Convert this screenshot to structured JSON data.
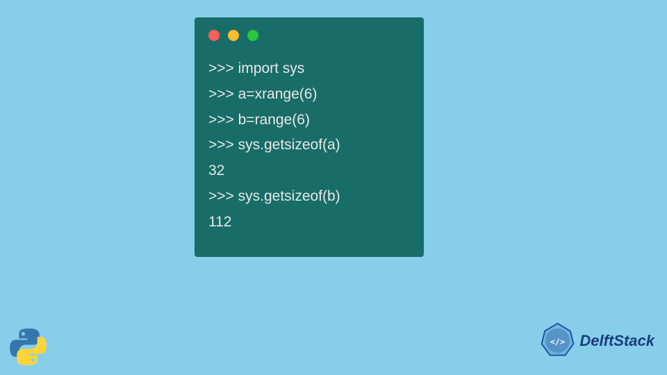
{
  "terminal": {
    "lines": [
      ">>> import sys",
      ">>> a=xrange(6)",
      ">>> b=range(6)",
      ">>> sys.getsizeof(a)",
      "32",
      ">>> sys.getsizeof(b)",
      "112"
    ]
  },
  "branding": {
    "name": "DelftStack"
  },
  "colors": {
    "background": "#87ceeb",
    "terminal": "#186d68",
    "text": "#e8e8e8",
    "dotRed": "#ff5f56",
    "dotYellow": "#ffbd2e",
    "dotGreen": "#27c93f"
  }
}
